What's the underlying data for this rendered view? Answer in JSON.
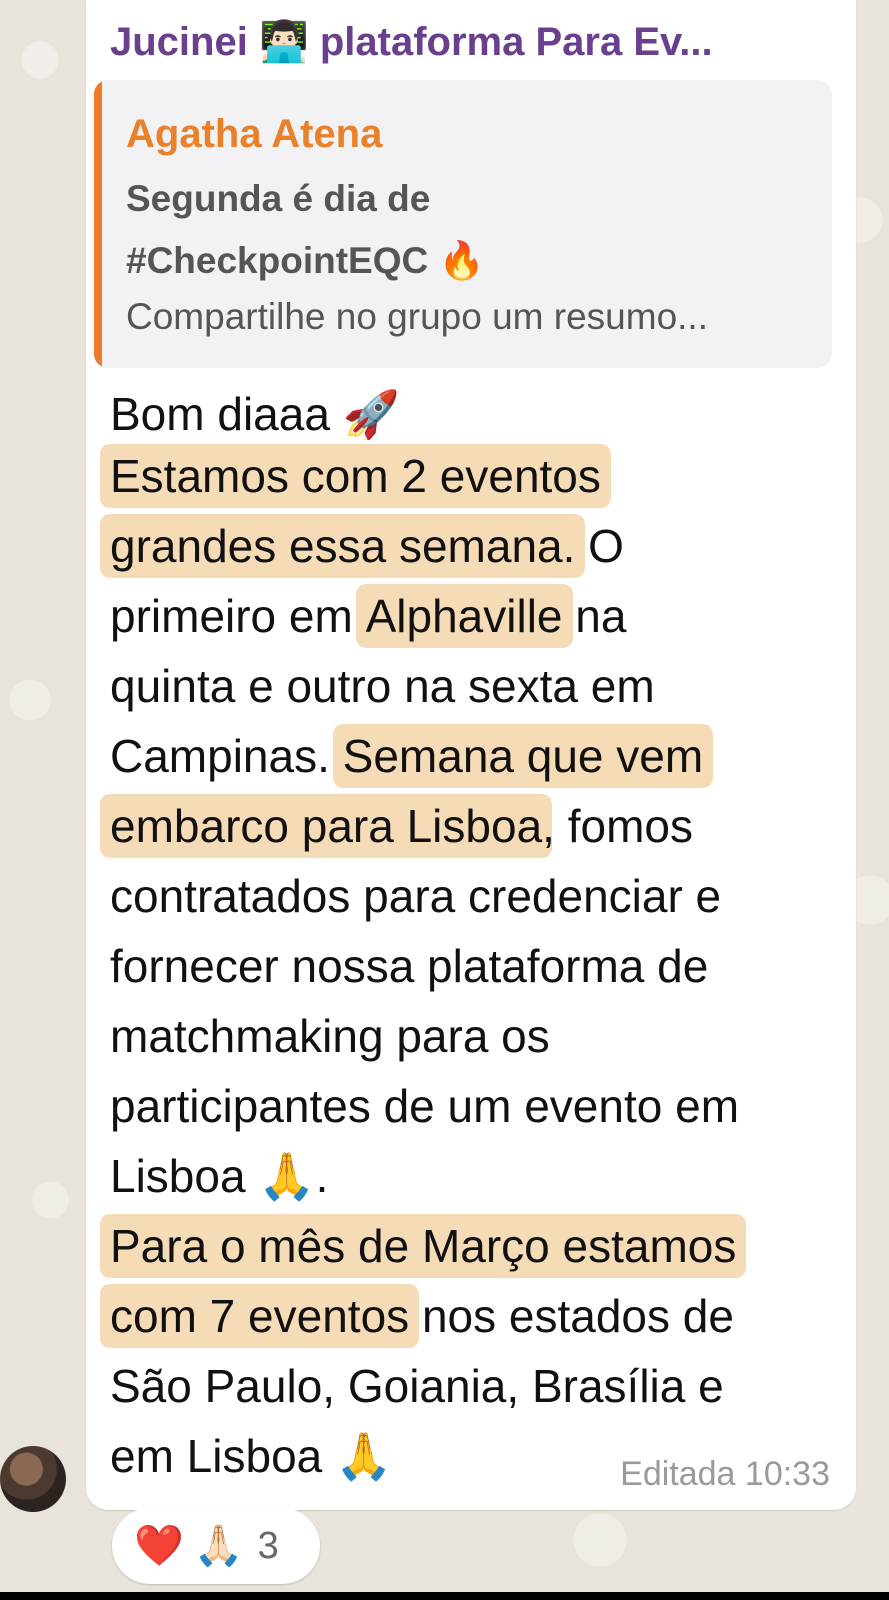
{
  "header": {
    "sender_name": "Jucinei 👨🏻‍💻 plataforma Para Ev..."
  },
  "quote": {
    "author": "Agatha Atena",
    "line1": "Segunda é dia de",
    "line2": "#CheckpointEQC 🔥",
    "preview": "Compartilhe no grupo um resumo..."
  },
  "message": {
    "lines": [
      "Bom diaaa 🚀",
      "Estamos com 2 eventos",
      "grandes essa semana.",
      " O",
      "primeiro em ",
      "Alphaville",
      " na",
      "quinta e outro na sexta em",
      "Campinas. ",
      "Semana que vem",
      "embarco para Lisboa",
      ", fomos",
      "contratados para credenciar e",
      "fornecer nossa plataforma de",
      "matchmaking para os",
      "participantes de um evento em",
      "Lisboa 🙏.",
      "Para o mês de Março estamos",
      "com 7 eventos",
      " nos estados de",
      "São Paulo, Goiania, Brasília e",
      "em Lisboa 🙏"
    ],
    "meta": "Editada 10:33"
  },
  "reactions": {
    "emoji_1": "❤️",
    "emoji_2": "🙏🏻",
    "count": "3"
  },
  "colors": {
    "sender": "#6a3f8e",
    "quote_author": "#e9802a",
    "quote_bar": "#ee7b28",
    "highlight": "#efbe7c"
  }
}
